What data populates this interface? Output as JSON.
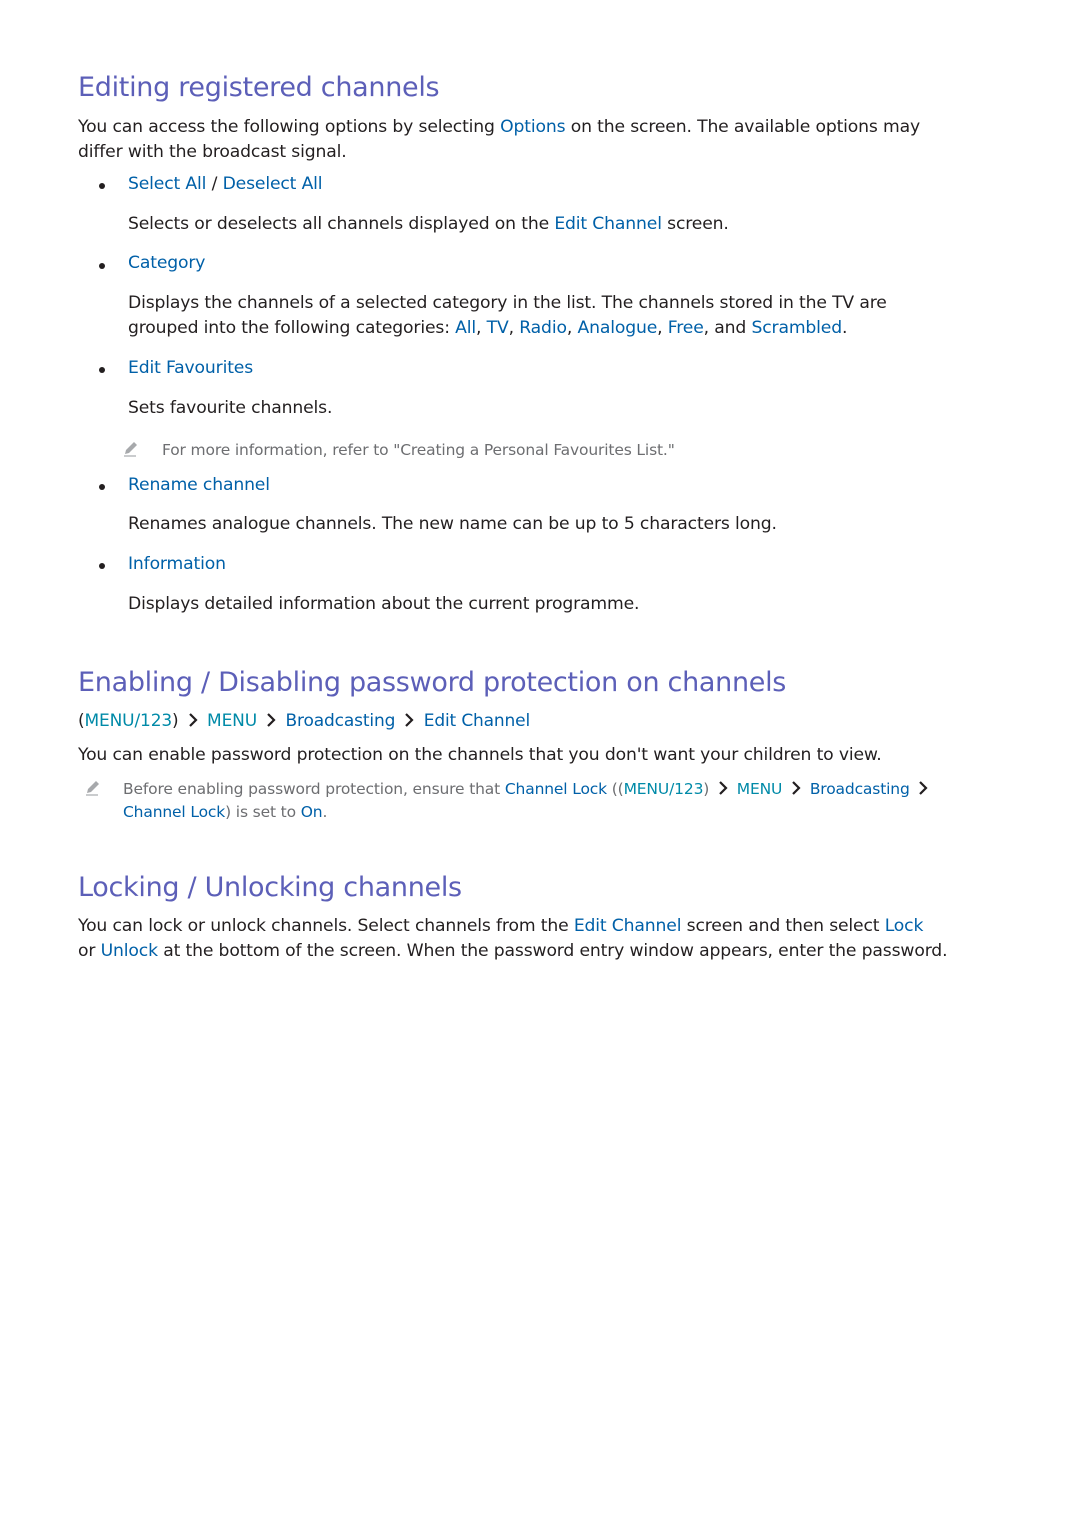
{
  "colors": {
    "heading": "#5c5fb8",
    "link": "#0060a8",
    "teal_link": "#008aa8",
    "body_text": "#231f20",
    "note_text": "#6d6e71"
  },
  "section1": {
    "title": "Editing registered channels",
    "intro_a": "You can access the following options by selecting ",
    "intro_options": "Options",
    "intro_b": " on the screen. The available options may",
    "intro_line2": "differ with the broadcast signal.",
    "items": [
      {
        "label_a": "Select All",
        "label_sep": " / ",
        "label_b": "Deselect All",
        "desc_a": "Selects or deselects all channels displayed on the ",
        "desc_link": "Edit Channel",
        "desc_b": " screen."
      },
      {
        "label": "Category",
        "desc_line1": "Displays the channels of a selected category in the list. The channels stored in the TV are",
        "desc_line2_a": "grouped into the following categories: ",
        "categories": [
          "All",
          "TV",
          "Radio",
          "Analogue",
          "Free",
          "Scrambled"
        ],
        "sep": ", ",
        "and": ", and ",
        "end": "."
      },
      {
        "label": "Edit Favourites",
        "desc": "Sets favourite channels.",
        "note_icon": "pencil-icon",
        "note": "For more information, refer to \"Creating a Personal Favourites List.\""
      },
      {
        "label": "Rename channel",
        "desc": "Renames analogue channels. The new name can be up to 5 characters long."
      },
      {
        "label": "Information",
        "desc": "Displays detailed information about the current programme."
      }
    ]
  },
  "section2": {
    "title": "Enabling / Disabling password protection on channels",
    "path": {
      "open": "(",
      "menu123": "MENU/123",
      "close": ")",
      "chevron_icon": "chevron-right-icon",
      "menu": "MENU",
      "broadcasting": "Broadcasting",
      "edit_channel": "Edit Channel"
    },
    "body": "You can enable password protection on the channels that you don't want your children to view.",
    "note_icon": "pencil-icon",
    "note_a": "Before enabling password protection, ensure that ",
    "note_channel_lock": "Channel Lock",
    "note_open": " ((",
    "note_menu123": "MENU/123",
    "note_close": ")",
    "note_menu": "MENU",
    "note_broadcasting": "Broadcasting",
    "note_channel_lock2": "Channel Lock",
    "note_b": ") is set to ",
    "note_on": "On",
    "note_end": "."
  },
  "section3": {
    "title": "Locking / Unlocking channels",
    "line1_a": "You can lock or unlock channels. Select channels from the ",
    "line1_link": "Edit Channel",
    "line1_b": " screen and then select ",
    "line1_lock": "Lock",
    "line2_a": "or ",
    "line2_unlock": "Unlock",
    "line2_b": " at the bottom of the screen. When the password entry window appears, enter the password."
  }
}
